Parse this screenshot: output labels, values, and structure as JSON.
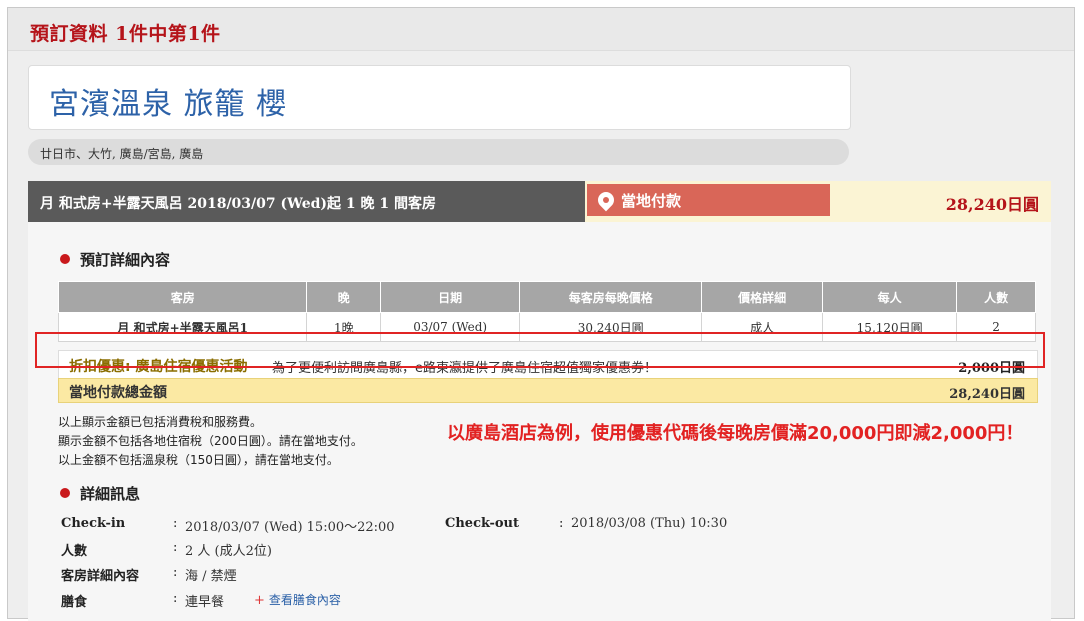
{
  "header": {
    "title": "預訂資料  1件中第1件"
  },
  "hotel": {
    "name": "宮濱溫泉 旅籠 櫻",
    "location": "廿日市、大竹, 廣島/宮島, 廣島"
  },
  "room_bar": {
    "text": "月 和式房+半露天風呂   2018/03/07 (Wed)起   1 晚   1 間客房"
  },
  "payment": {
    "label": "當地付款",
    "amount": "28,240日圓",
    "icon": "location-pin-icon"
  },
  "booking_section": {
    "title": "預訂詳細內容"
  },
  "table": {
    "headers": [
      "客房",
      "晚",
      "日期",
      "每客房每晚價格",
      "價格詳細",
      "每人",
      "人數"
    ],
    "rows": [
      [
        "月 和式房+半露天風呂1",
        "1晚",
        "03/07 (Wed)",
        "30,240日圓",
        "成人",
        "15,120日圓",
        "2"
      ]
    ]
  },
  "discount": {
    "label": "折扣優惠: 廣島住宿優惠活動",
    "description": "為了更便利訪問廣島縣，e路東瀛提供了廣島住宿超值獨家優惠券！",
    "amount": "2,000日圓"
  },
  "total": {
    "label": "當地付款總金額",
    "amount": "28,240日圓"
  },
  "notes": [
    "以上顯示金額已包括消費稅和服務費。",
    "顯示金額不包括各地住宿稅（200日圓）。請在當地支付。",
    "以上金額不包括溫泉稅（150日圓），請在當地支付。"
  ],
  "promo_text": "以廣島酒店為例，使用優惠代碼後每晚房價滿20,000円即減2,000円！",
  "details_section": {
    "title": "詳細訊息",
    "checkin_label": "Check-in",
    "checkin_value": "2018/03/07 (Wed) 15:00～22:00",
    "checkout_label": "Check-out",
    "checkout_value": "2018/03/08 (Thu) 10:30",
    "guests_label": "人數",
    "guests_value": "2 人 (成人2位)",
    "room_detail_label": "客房詳細內容",
    "room_detail_value": "海 / 禁煙",
    "meal_label": "膳食",
    "meal_value": "連早餐",
    "meal_link": "查看膳食內容"
  },
  "colors": {
    "accent_red": "#b5141a",
    "highlight_border": "#e02424",
    "link_blue": "#2d62a8"
  }
}
